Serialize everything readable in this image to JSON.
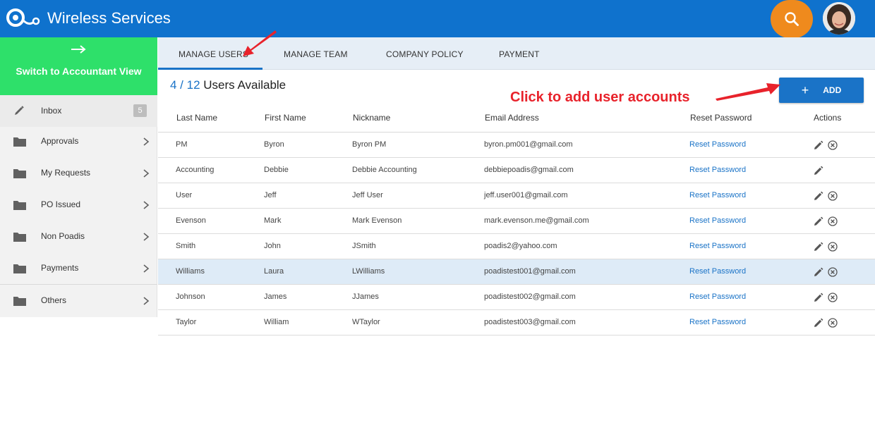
{
  "header": {
    "title": "Wireless Services",
    "icons": {
      "logo": "logo-icon",
      "search": "search-icon",
      "avatar": "avatar"
    },
    "colors": {
      "bar": "#0f72cd",
      "search": "#ef8a1d"
    }
  },
  "sidebar": {
    "switch_label": "Switch to Accountant View",
    "switch_icon": "arrow-right-icon",
    "inbox": {
      "label": "Inbox",
      "badge": "5"
    },
    "items": [
      {
        "label": "Approvals"
      },
      {
        "label": "My Requests"
      },
      {
        "label": "PO Issued"
      },
      {
        "label": "Non Poadis"
      },
      {
        "label": "Payments"
      },
      {
        "label": "Others"
      }
    ],
    "colors": {
      "switch": "#2ee06a"
    }
  },
  "tabs": [
    {
      "label": "MANAGE USERS",
      "active": true
    },
    {
      "label": "MANAGE TEAM"
    },
    {
      "label": "COMPANY POLICY"
    },
    {
      "label": "PAYMENT"
    }
  ],
  "summary": {
    "count": "4 / 12",
    "text": "Users Available"
  },
  "add_button": {
    "label": "ADD",
    "icon": "plus-icon"
  },
  "annotation": {
    "text": "Click to add user accounts",
    "color": "#e8222b"
  },
  "table": {
    "columns": [
      "Last Name",
      "First Name",
      "Nickname",
      "Email Address",
      "Reset Password",
      "Actions"
    ],
    "rows": [
      {
        "last": "PM",
        "first": "Byron",
        "nick": "Byron PM",
        "email": "byron.pm001@gmail.com",
        "reset": "Reset Password",
        "deletable": true
      },
      {
        "last": "Accounting",
        "first": "Debbie",
        "nick": "Debbie Accounting",
        "email": "debbiepoadis@gmail.com",
        "reset": "Reset Password",
        "deletable": false
      },
      {
        "last": "User",
        "first": "Jeff",
        "nick": "Jeff User",
        "email": "jeff.user001@gmail.com",
        "reset": "Reset Password",
        "deletable": true
      },
      {
        "last": "Evenson",
        "first": "Mark",
        "nick": "Mark Evenson",
        "email": "mark.evenson.me@gmail.com",
        "reset": "Reset Password",
        "deletable": true
      },
      {
        "last": "Smith",
        "first": "John",
        "nick": "JSmith",
        "email": "poadis2@yahoo.com",
        "reset": "Reset Password",
        "deletable": true
      },
      {
        "last": "Williams",
        "first": "Laura",
        "nick": "LWilliams",
        "email": "poadistest001@gmail.com",
        "reset": "Reset Password",
        "deletable": true,
        "selected": true
      },
      {
        "last": "Johnson",
        "first": "James",
        "nick": "JJames",
        "email": "poadistest002@gmail.com",
        "reset": "Reset Password",
        "deletable": true
      },
      {
        "last": "Taylor",
        "first": "William",
        "nick": "WTaylor",
        "email": "poadistest003@gmail.com",
        "reset": "Reset Password",
        "deletable": true
      }
    ]
  }
}
